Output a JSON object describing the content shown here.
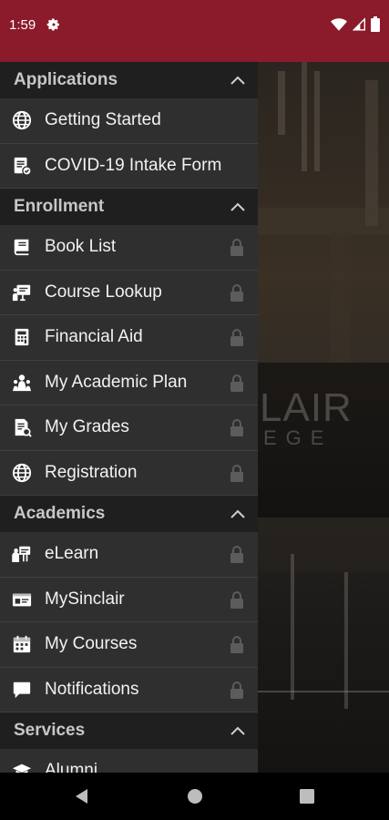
{
  "status": {
    "time": "1:59"
  },
  "sections": [
    {
      "title": "Applications",
      "items": [
        {
          "label": "Getting Started",
          "icon": "globe-icon",
          "locked": false
        },
        {
          "label": "COVID-19 Intake Form",
          "icon": "form-icon",
          "locked": false
        }
      ]
    },
    {
      "title": "Enrollment",
      "items": [
        {
          "label": "Book List",
          "icon": "book-icon",
          "locked": true
        },
        {
          "label": "Course Lookup",
          "icon": "presentation-icon",
          "locked": true
        },
        {
          "label": "Financial Aid",
          "icon": "calculator-icon",
          "locked": true
        },
        {
          "label": "My Academic Plan",
          "icon": "users-icon",
          "locked": true
        },
        {
          "label": "My Grades",
          "icon": "report-icon",
          "locked": true
        },
        {
          "label": "Registration",
          "icon": "globe-icon",
          "locked": true
        }
      ]
    },
    {
      "title": "Academics",
      "items": [
        {
          "label": "eLearn",
          "icon": "teacher-icon",
          "locked": true
        },
        {
          "label": "MySinclair",
          "icon": "id-card-icon",
          "locked": true
        },
        {
          "label": "My Courses",
          "icon": "calendar-icon",
          "locked": true
        },
        {
          "label": "Notifications",
          "icon": "chat-icon",
          "locked": true
        }
      ]
    },
    {
      "title": "Services",
      "items": [
        {
          "label": "Alumni",
          "icon": "graduation-cap-icon",
          "locked": false
        }
      ]
    }
  ],
  "background_logo": {
    "line1": "LAIR",
    "line2": "EGE"
  },
  "colors": {
    "status_bar": "#8b1a2b",
    "drawer": "#2f2f2f",
    "section_header": "#1f1f1f",
    "text": "#f2f2f2"
  }
}
